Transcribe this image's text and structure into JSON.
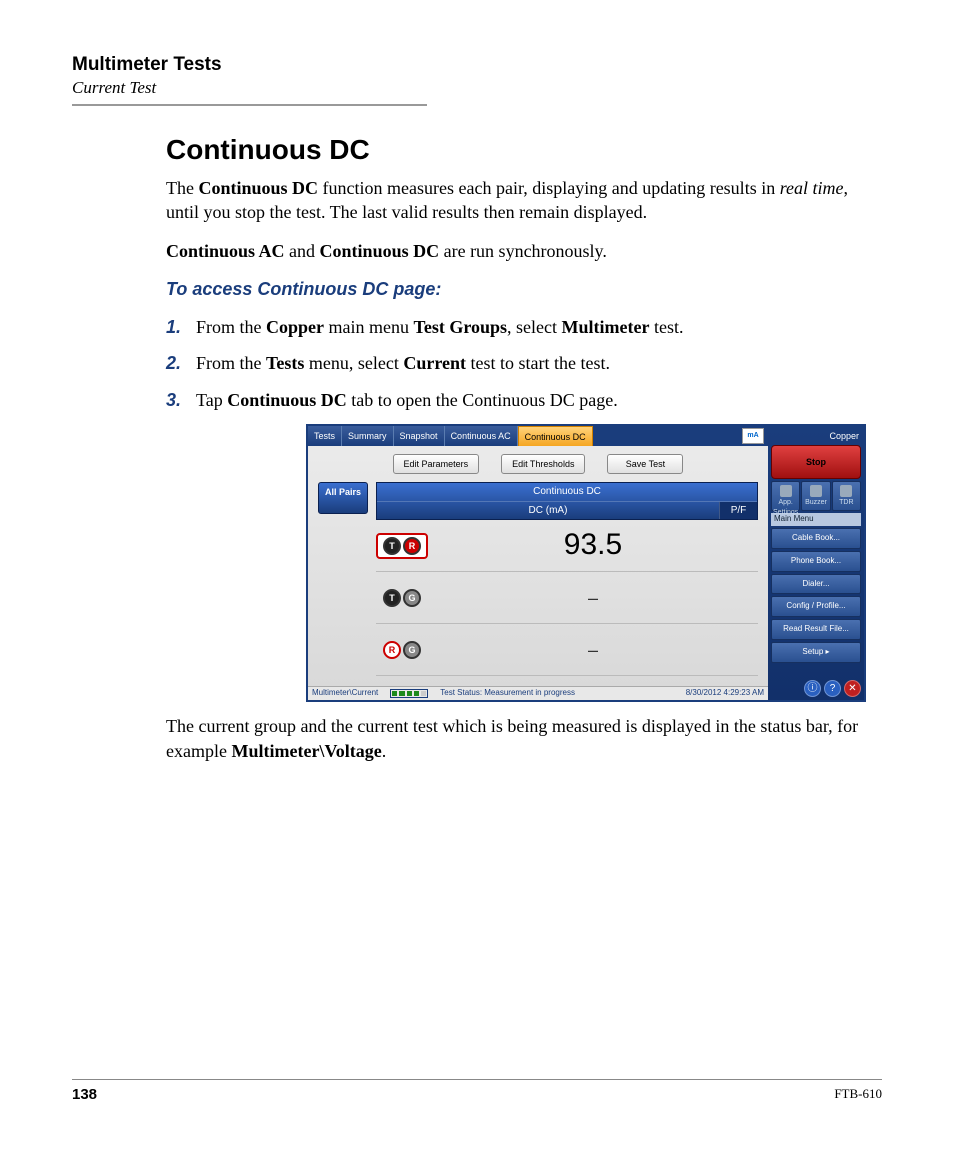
{
  "header": {
    "title": "Multimeter Tests",
    "subtitle": "Current Test"
  },
  "section_title": "Continuous DC",
  "para1": {
    "pre": "The ",
    "b1": "Continuous DC",
    "mid1": " function measures each pair, displaying and updating results in ",
    "i1": "real time",
    "mid2": ", until you stop the test. The last valid results then remain displayed."
  },
  "para2": {
    "b1": "Continuous AC",
    "mid": " and ",
    "b2": "Continuous DC",
    "tail": " are run synchronously."
  },
  "instr_head": "To access Continuous DC page:",
  "steps": [
    {
      "num": "1.",
      "parts": [
        "From the ",
        "Copper",
        " main menu ",
        "Test Groups",
        ", select ",
        "Multimeter",
        " test."
      ]
    },
    {
      "num": "2.",
      "parts": [
        "From the ",
        "Tests",
        " menu, select ",
        "Current",
        " test to start the test."
      ]
    },
    {
      "num": "3.",
      "parts": [
        "Tap ",
        "Continuous DC",
        " tab to open the Continuous DC page."
      ]
    }
  ],
  "para3": {
    "pre": "The current group and the current test which is being measured is displayed in the status bar, for example ",
    "b1": "Multimeter\\Voltage",
    "tail": "."
  },
  "mock": {
    "tabs": [
      "Tests",
      "Summary",
      "Snapshot",
      "Continuous AC",
      "Continuous DC"
    ],
    "active_tab_index": 4,
    "top_icon": "mA",
    "side_top": "Copper",
    "actions": [
      "Edit Parameters",
      "Edit Thresholds",
      "Save Test"
    ],
    "allpairs": "All Pairs",
    "data_title": "Continuous DC",
    "data_col1": "DC (mA)",
    "data_col2": "P/F",
    "rows": [
      {
        "pair": [
          "T",
          "R"
        ],
        "colors": [
          "t",
          "r"
        ],
        "value": "93.5",
        "active": true
      },
      {
        "pair": [
          "T",
          "G"
        ],
        "colors": [
          "t",
          "g"
        ],
        "value": "–",
        "active": false
      },
      {
        "pair": [
          "R",
          "G"
        ],
        "colors": [
          "r",
          "g"
        ],
        "value": "–",
        "active": false
      }
    ],
    "stop": "Stop",
    "side_icons": [
      "App. Settings",
      "Buzzer",
      "TDR"
    ],
    "side_menu_title": "Main Menu",
    "side_menu": [
      "Cable Book...",
      "Phone Book...",
      "Dialer...",
      "Config / Profile...",
      "Read Result File...",
      "Setup     ▸"
    ],
    "status": {
      "path": "Multimeter\\Current",
      "msg": "Test Status: Measurement in progress",
      "time": "8/30/2012 4:29:23 AM"
    }
  },
  "footer": {
    "page": "138",
    "model": "FTB-610"
  }
}
